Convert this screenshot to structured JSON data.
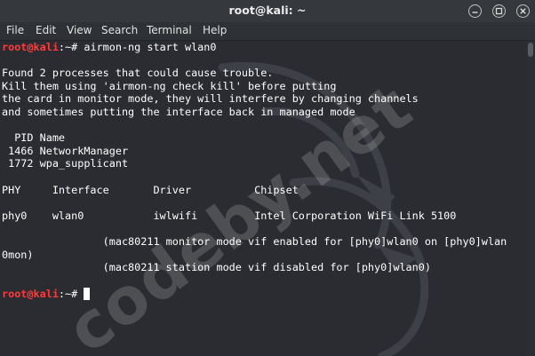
{
  "window": {
    "title": "root@kali: ~",
    "controls": [
      "minimize-icon",
      "maximize-icon",
      "close-icon"
    ]
  },
  "menu": [
    "File",
    "Edit",
    "View",
    "Search",
    "Terminal",
    "Help"
  ],
  "prompt": {
    "user_host": "root@kali",
    "path": ":~# ",
    "command": "airmon-ng start wlan0"
  },
  "output": [
    "",
    "Found 2 processes that could cause trouble.",
    "Kill them using 'airmon-ng check kill' before putting",
    "the card in monitor mode, they will interfere by changing channels",
    "and sometimes putting the interface back in managed mode",
    "",
    "  PID Name",
    " 1466 NetworkManager",
    " 1772 wpa_supplicant",
    "",
    "PHY     Interface       Driver          Chipset",
    "",
    "phy0    wlan0           iwlwifi         Intel Corporation WiFi Link 5100",
    "",
    "                (mac80211 monitor mode vif enabled for [phy0]wlan0 on [phy0]wlan",
    "0mon)",
    "                (mac80211 station mode vif disabled for [phy0]wlan0)",
    ""
  ],
  "watermark": "codeby.net",
  "colors": {
    "prompt_user": "#ff3b3b",
    "terminal_bg": "#2a2c31",
    "titlebar_bg": "#35383c",
    "text": "#ffffff"
  }
}
